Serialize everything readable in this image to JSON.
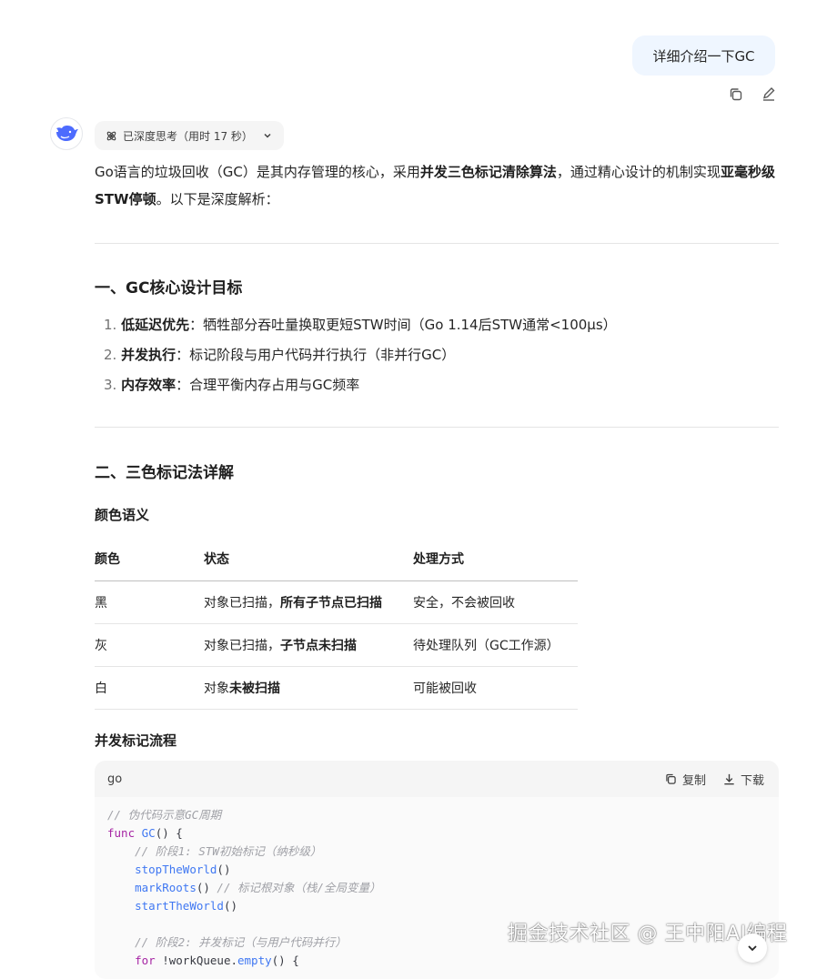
{
  "user_message": {
    "text": "详细介绍一下GC"
  },
  "thinking": {
    "label": "已深度思考（用时 17 秒）"
  },
  "intro": {
    "p1": "Go语言的垃圾回收（GC）是其内存管理的核心，采用",
    "b1": "并发三色标记清除算法",
    "p2": "，通过精心设计的机制实现",
    "b2": "亚毫秒级STW停顿",
    "p3": "。以下是深度解析："
  },
  "section1": {
    "title": "一、GC核心设计目标",
    "items": [
      {
        "num": "1.",
        "bold": "低延迟优先",
        "text": "：牺牲部分吞吐量换取更短STW时间（Go 1.14后STW通常<100μs）"
      },
      {
        "num": "2.",
        "bold": "并发执行",
        "text": "：标记阶段与用户代码并行执行（非并行GC）"
      },
      {
        "num": "3.",
        "bold": "内存效率",
        "text": "：合理平衡内存占用与GC频率"
      }
    ]
  },
  "section2": {
    "title": "二、三色标记法详解",
    "subtitle": "颜色语义",
    "table": {
      "headers": [
        "颜色",
        "状态",
        "处理方式"
      ],
      "rows": [
        {
          "color": "黑",
          "state_plain": "对象已扫描，",
          "state_bold": "所有子节点已扫描",
          "action": "安全，不会被回收"
        },
        {
          "color": "灰",
          "state_plain": "对象已扫描，",
          "state_bold": "子节点未扫描",
          "action": "待处理队列（GC工作源）"
        },
        {
          "color": "白",
          "state_plain": "对象",
          "state_bold": "未被扫描",
          "action": "可能被回收"
        }
      ]
    },
    "flow_title": "并发标记流程"
  },
  "code": {
    "lang": "go",
    "copy_label": "复制",
    "download_label": "下载",
    "lines": {
      "c1": "// 伪代码示意GC周期",
      "kw_func": "func",
      "fn_gc": "GC",
      "sig_rest": "() {",
      "c2": "// 阶段1: STW初始标记（纳秒级）",
      "fn_stop": "stopTheWorld",
      "fn_mark": "markRoots",
      "c3": "// 标记根对象（栈/全局变量）",
      "fn_start": "startTheWorld",
      "c4": "// 阶段2: 并发标记（与用户代码并行）",
      "kw_for": "for",
      "for_mid": " !workQueue.",
      "fn_empty": "empty",
      "for_end": "() {"
    }
  },
  "watermark": "掘金技术社区 @ 王中阳AI编程"
}
